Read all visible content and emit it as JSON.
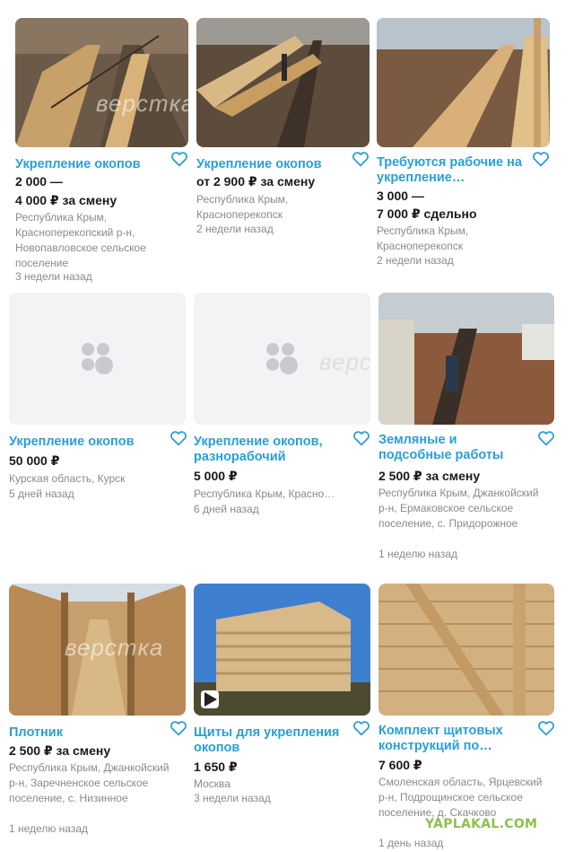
{
  "listings": [
    {
      "title": "Укрепление окопов",
      "price_lines": [
        "2 000 —",
        "4 000 ₽ за смену"
      ],
      "meta": "Республика Крым, Красноперекопский р-н, Новопавловское сельское поселение",
      "age": "3 недели назад",
      "image": "trench-photo"
    },
    {
      "title": "Укрепление окопов",
      "price_lines": [
        "от 2 900 ₽ за смену"
      ],
      "meta": "Республика Крым, Красноперекопск",
      "age": "2 недели назад",
      "image": "trench-photo"
    },
    {
      "title": "Требуются рабочие на укрепление…",
      "price_lines": [
        "3 000 —",
        "7 000 ₽ сдельно"
      ],
      "meta": "Республика Крым, Красноперекопск",
      "age": "2 недели назад",
      "image": "trench-photo"
    },
    {
      "title": "Укрепление окопов",
      "price_lines": [
        "50 000 ₽"
      ],
      "meta": "Курская область, Курск",
      "age": "5 дней назад",
      "image": "placeholder"
    },
    {
      "title": "Укрепление окопов, разнорабочий",
      "price_lines": [
        "5 000 ₽"
      ],
      "meta": "Республика Крым, Красно…",
      "age": "6 дней назад",
      "image": "placeholder"
    },
    {
      "title": "Земляные и подсобные работы",
      "price_lines": [
        "2 500 ₽ за смену"
      ],
      "meta": "Республика Крым, Джанкойский р-н, Ермаковское сельское поселение, с. Придорожное",
      "age": "1 неделю назад",
      "image": "trench-photo"
    },
    {
      "title": "Плотник",
      "price_lines": [
        "2 500 ₽ за смену"
      ],
      "meta": "Республика Крым, Джанкойский р-н, Заречненское сельское поселение, с. Низинное",
      "age": "1 неделю назад",
      "image": "wood-corridor-photo"
    },
    {
      "title": "Щиты для укрепления окопов",
      "price_lines": [
        "1 650 ₽"
      ],
      "meta": "Москва",
      "age": "3 недели назад",
      "image": "pallet-stack-photo"
    },
    {
      "title": "Комплект щитовых конструкций по…",
      "price_lines": [
        "7 600 ₽"
      ],
      "meta": "Смоленская область, Ярцевский р-н, Подрощинское сельское поселение, д. Скачково",
      "age": "1 день назад",
      "image": "wood-panel-photo"
    }
  ],
  "watermark": "верстка",
  "site_watermark": "YAPLAKAL.COM"
}
